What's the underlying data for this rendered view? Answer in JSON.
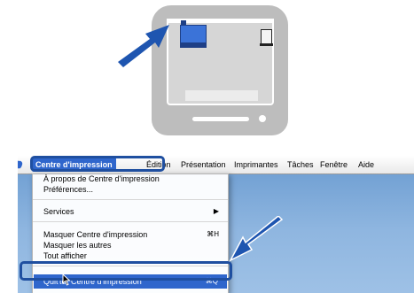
{
  "illustration": {
    "hd_icon": "hard-drive-icon",
    "trash_icon": "trash-icon",
    "arrow_color": "#1e55b0"
  },
  "menubar": {
    "apple_icon": "apple-icon",
    "app_menu": "Centre d'impression",
    "edition": "Édition",
    "presentation": "Présentation",
    "imprimantes": "Imprimantes",
    "taches": "Tâches",
    "fenetre": "Fenêtre",
    "aide": "Aide"
  },
  "dropdown": {
    "about": "À propos de Centre d'impression",
    "preferences": "Préférences...",
    "services": "Services",
    "services_arrow": "▶",
    "hide_app": "Masquer Centre d'impression",
    "hide_app_shortcut": "⌘H",
    "hide_others": "Masquer les autres",
    "show_all": "Tout afficher",
    "quit_pre": "Quit",
    "quit_post": "ter Centre d'impression",
    "quit_shortcut": "⌘Q"
  },
  "colors": {
    "highlight": "#2f66cc",
    "annotation_frame": "#1f4fa0",
    "desktop": "#8fb6e0"
  }
}
